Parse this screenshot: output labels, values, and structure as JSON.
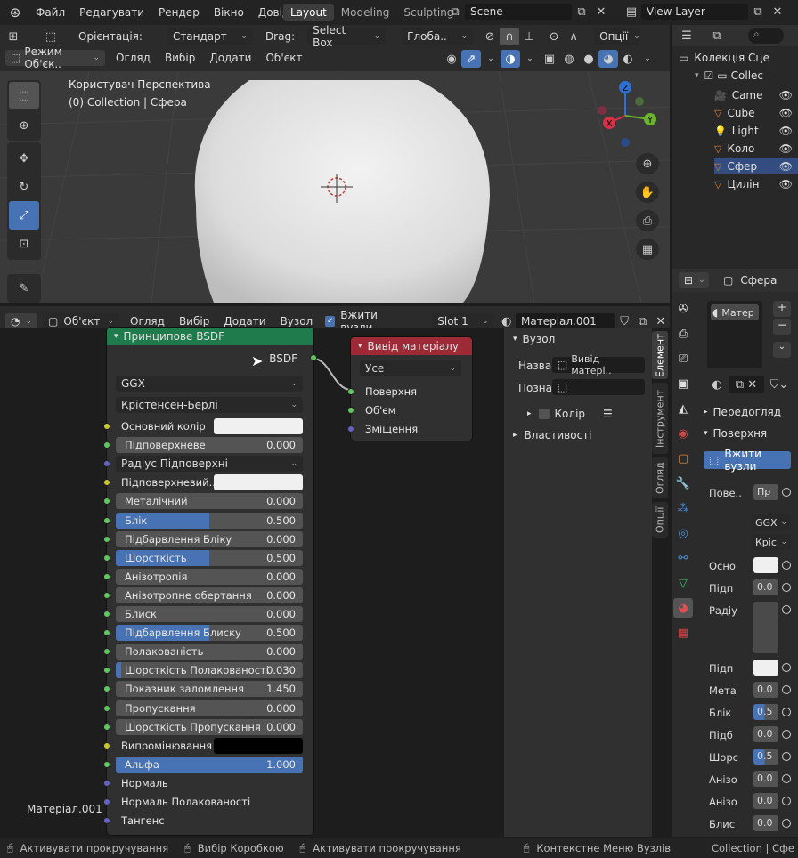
{
  "topbar": {
    "menu": [
      "Файл",
      "Редагувати",
      "Рендер",
      "Вікно",
      "Довідка"
    ],
    "workspaces": [
      "Layout",
      "Modeling",
      "Sculpting"
    ],
    "scene": "Scene",
    "view_layer": "View Layer"
  },
  "viewport": {
    "orientation_label": "Орієнтація:",
    "orientation_value": "Стандарт",
    "drag_label": "Drag:",
    "drag_value": "Select Box",
    "transform_value": "Глоба..",
    "options": "Опції",
    "mode": "Режим Об'єк..",
    "menu": [
      "Огляд",
      "Вибір",
      "Додати",
      "Об'єкт"
    ],
    "info_line1": "Користувач Перспектива",
    "info_line2": "(0) Collection | Сфера",
    "gizmo": {
      "z": "Z",
      "y": "Y",
      "x": "X"
    }
  },
  "outliner": {
    "root": "Колекція Сце",
    "collection": "Collec",
    "items": [
      "Came",
      "Cube",
      "Light",
      "Коло",
      "Сфер",
      "Цилін"
    ]
  },
  "node_editor": {
    "type": "Об'єкт",
    "menu": [
      "Огляд",
      "Вибір",
      "Додати",
      "Вузол"
    ],
    "use_nodes": "Вжити вузли",
    "slot": "Slot 1",
    "material": "Матеріал.001",
    "material_label": "Матеріал.001",
    "bsdf": {
      "title": "Принципове BSDF",
      "output": "BSDF",
      "distribution": "GGX",
      "subsurface_method": "Крістенсен-Берлі",
      "rows": [
        {
          "label": "Основний колір",
          "kind": "color",
          "color": "#f0f0f0",
          "sock": "y"
        },
        {
          "label": "Підповерхневе",
          "kind": "value",
          "value": "0.000",
          "fill": 0,
          "sock": "g"
        },
        {
          "label": "Радіус Підповерхні",
          "kind": "dropdown",
          "sock": "b"
        },
        {
          "label": "Підповерхневий..",
          "kind": "color",
          "color": "#f0f0f0",
          "sock": "y"
        },
        {
          "label": "Металічний",
          "kind": "value",
          "value": "0.000",
          "fill": 0,
          "sock": "g"
        },
        {
          "label": "Блік",
          "kind": "value",
          "value": "0.500",
          "fill": 0.5,
          "sock": "g"
        },
        {
          "label": "Підбарвлення Бліку",
          "kind": "value",
          "value": "0.000",
          "fill": 0,
          "sock": "g"
        },
        {
          "label": "Шорсткість",
          "kind": "value",
          "value": "0.500",
          "fill": 0.5,
          "sock": "g"
        },
        {
          "label": "Анізотропія",
          "kind": "value",
          "value": "0.000",
          "fill": 0,
          "sock": "g"
        },
        {
          "label": "Анізотропне обертання",
          "kind": "value",
          "value": "0.000",
          "fill": 0,
          "sock": "g"
        },
        {
          "label": "Блиск",
          "kind": "value",
          "value": "0.000",
          "fill": 0,
          "sock": "g"
        },
        {
          "label": "Підбарвлення Блиску",
          "kind": "value",
          "value": "0.500",
          "fill": 0.5,
          "sock": "g"
        },
        {
          "label": "Полакованість",
          "kind": "value",
          "value": "0.000",
          "fill": 0,
          "sock": "g"
        },
        {
          "label": "Шорсткість Полакованості",
          "kind": "value",
          "value": "0.030",
          "fill": 0.03,
          "sock": "g"
        },
        {
          "label": "Показник заломлення",
          "kind": "value",
          "value": "1.450",
          "fill": 0,
          "sock": "g"
        },
        {
          "label": "Пропускання",
          "kind": "value",
          "value": "0.000",
          "fill": 0,
          "sock": "g"
        },
        {
          "label": "Шорсткість Пропускання",
          "kind": "value",
          "value": "0.000",
          "fill": 0,
          "sock": "g"
        },
        {
          "label": "Випромінювання",
          "kind": "color",
          "color": "#000000",
          "sock": "y"
        },
        {
          "label": "Альфа",
          "kind": "value",
          "value": "1.000",
          "fill": 1,
          "sock": "g"
        },
        {
          "label": "Нормаль",
          "kind": "plain",
          "sock": "b"
        },
        {
          "label": "Нормаль Полакованості",
          "kind": "plain",
          "sock": "b"
        },
        {
          "label": "Тангенс",
          "kind": "plain",
          "sock": "b"
        }
      ]
    },
    "output_node": {
      "title": "Вивід матеріалу",
      "target": "Усе",
      "inputs": [
        "Поверхня",
        "Об'єм",
        "Зміщення"
      ]
    },
    "sidebar": {
      "section": "Вузол",
      "name_label": "Назва",
      "name_value": "Вивід матері..",
      "label_label": "Позна",
      "color_label": "Колір",
      "props_label": "Властивості",
      "tabs": [
        "Елемент",
        "Інструмент",
        "Огляд",
        "Опції"
      ]
    }
  },
  "properties": {
    "object": "Сфера",
    "material_slot": "Матер",
    "preview": "Передогляд",
    "surface": "Поверхня",
    "use_nodes": "Вжити вузли",
    "rows": [
      {
        "label": "Пове..",
        "value": "Пр",
        "blue": false
      },
      {
        "label": "Осно",
        "value": "",
        "blue": false,
        "swatch": true
      },
      {
        "label": "Підп",
        "value": "0.0",
        "blue": false
      },
      {
        "label": "Радіу",
        "value": "",
        "blue": false
      },
      {
        "label": "Підп",
        "value": "",
        "blue": false,
        "swatch": true
      },
      {
        "label": "Мета",
        "value": "0.0",
        "blue": false
      },
      {
        "label": "Блік",
        "value": "0.5",
        "blue": true
      },
      {
        "label": "Підб",
        "value": "0.0",
        "blue": false
      },
      {
        "label": "Шорс",
        "value": "0.5",
        "blue": true
      },
      {
        "label": "Анізо",
        "value": "0.0",
        "blue": false
      },
      {
        "label": "Анізо",
        "value": "0.0",
        "blue": false
      },
      {
        "label": "Блис",
        "value": "0.0",
        "blue": false
      }
    ],
    "ggx": "GGX",
    "kris": "Кріс"
  },
  "statusbar": {
    "items": [
      "Активувати прокручування",
      "Вибір Коробкою",
      "Активувати прокручування",
      "Контекстне Меню Вузлів"
    ],
    "right": "Collection | Сфе"
  }
}
